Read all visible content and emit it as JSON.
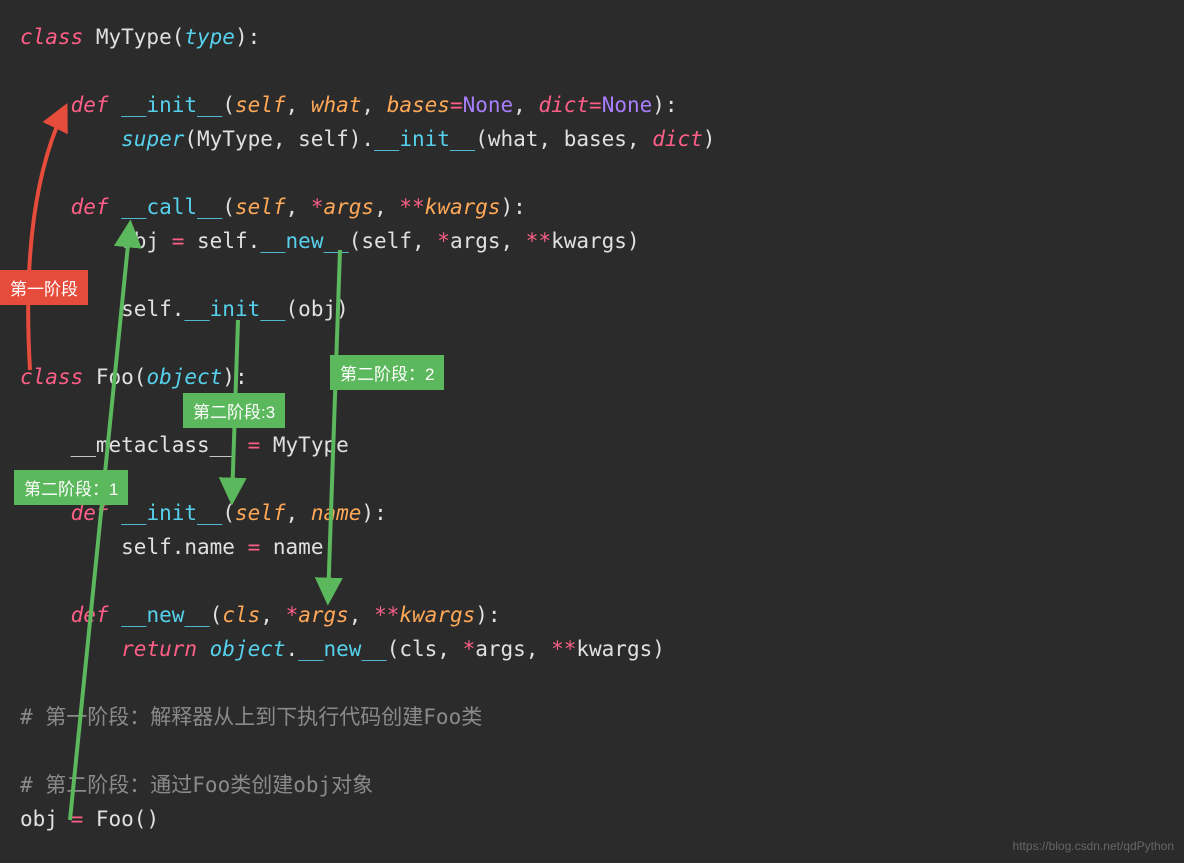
{
  "code": {
    "l1_class": "class",
    "l1_name": " MyType(",
    "l1_type": "type",
    "l1_end": "):",
    "l3_def": "def",
    "l3_fn": " __init__",
    "l3_open": "(",
    "l3_self": "self",
    "l3_c1": ", ",
    "l3_what": "what",
    "l3_c2": ", ",
    "l3_bases": "bases",
    "l3_eq1": "=",
    "l3_none1": "None",
    "l3_c3": ", ",
    "l3_dict": "dict",
    "l3_eq2": "=",
    "l3_none2": "None",
    "l3_close": "):",
    "l4_super": "super",
    "l4_args": "(MyType, self).",
    "l4_init": "__init__",
    "l4_rest": "(what, bases, ",
    "l4_dict": "dict",
    "l4_end": ")",
    "l6_def": "def",
    "l6_fn": " __call__",
    "l6_open": "(",
    "l6_self": "self",
    "l6_c1": ", ",
    "l6_star1": "*",
    "l6_args": "args",
    "l6_c2": ", ",
    "l6_star2": "**",
    "l6_kwargs": "kwargs",
    "l6_close": "):",
    "l7_a": "obj ",
    "l7_eq": "=",
    "l7_b": " self.",
    "l7_new": "__new__",
    "l7_c": "(self, ",
    "l7_star1": "*",
    "l7_d": "args, ",
    "l7_star2": "**",
    "l7_e": "kwargs)",
    "l9_a": "self.",
    "l9_init": "__init__",
    "l9_b": "(obj)",
    "l11_class": "class",
    "l11_name": " Foo(",
    "l11_obj": "object",
    "l11_end": "):",
    "l13_meta": "__metaclass__ ",
    "l13_eq": "=",
    "l13_val": " MyType",
    "l15_def": "def",
    "l15_fn": " __init__",
    "l15_open": "(",
    "l15_self": "self",
    "l15_c": ", ",
    "l15_name": "name",
    "l15_close": "):",
    "l16_a": "self.name ",
    "l16_eq": "=",
    "l16_b": " name",
    "l18_def": "def",
    "l18_fn": " __new__",
    "l18_open": "(",
    "l18_cls": "cls",
    "l18_c1": ", ",
    "l18_star1": "*",
    "l18_args": "args",
    "l18_c2": ", ",
    "l18_star2": "**",
    "l18_kwargs": "kwargs",
    "l18_close": "):",
    "l19_ret": "return",
    "l19_obj": " object",
    "l19_dot": ".",
    "l19_new": "__new__",
    "l19_a": "(cls, ",
    "l19_star1": "*",
    "l19_b": "args, ",
    "l19_star2": "**",
    "l19_c": "kwargs)",
    "l21": "# 第一阶段：解释器从上到下执行代码创建Foo类",
    "l23": "# 第二阶段：通过Foo类创建obj对象",
    "l24_a": "obj ",
    "l24_eq": "=",
    "l24_b": " Foo()"
  },
  "labels": {
    "stage1": "第一阶段",
    "stage2_1": "第二阶段：1",
    "stage2_2": "第二阶段：2",
    "stage2_3": "第二阶段:3"
  },
  "watermark": "https://blog.csdn.net/qdPython"
}
